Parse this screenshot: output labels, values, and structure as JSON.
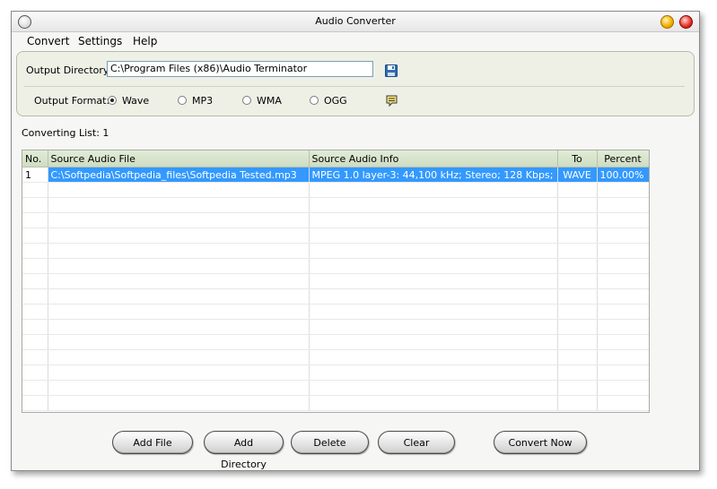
{
  "window": {
    "title": "Audio Converter"
  },
  "menu": [
    "Convert",
    "Settings",
    "Help"
  ],
  "output": {
    "directory_label": "Output Directory:",
    "directory_value": "C:\\Program Files (x86)\\Audio Terminator",
    "format_label": "Output Format:",
    "formats": [
      {
        "label": "Wave",
        "checked": true
      },
      {
        "label": "MP3",
        "checked": false
      },
      {
        "label": "WMA",
        "checked": false
      },
      {
        "label": "OGG",
        "checked": false
      }
    ]
  },
  "converting_list_label": "Converting List: 1",
  "table": {
    "headers": [
      "No.",
      "Source Audio File",
      "Source Audio Info",
      "To",
      "Percent"
    ],
    "rows": [
      [
        "1",
        "C:\\Softpedia\\Softpedia_files\\Softpedia Tested.mp3",
        "MPEG 1.0 layer-3: 44,100 kHz; Stereo; 128 Kbps;",
        "WAVE",
        "100.00%"
      ]
    ],
    "selected_row": 0
  },
  "buttons": {
    "add_file": "Add File",
    "add_directory": "Add Directory",
    "delete": "Delete",
    "clear": "Clear",
    "convert_now": "Convert Now"
  },
  "colors": {
    "selection": "#3399ff",
    "header_bg": "#d8e4cc",
    "panel_bg": "#eef0e6"
  }
}
